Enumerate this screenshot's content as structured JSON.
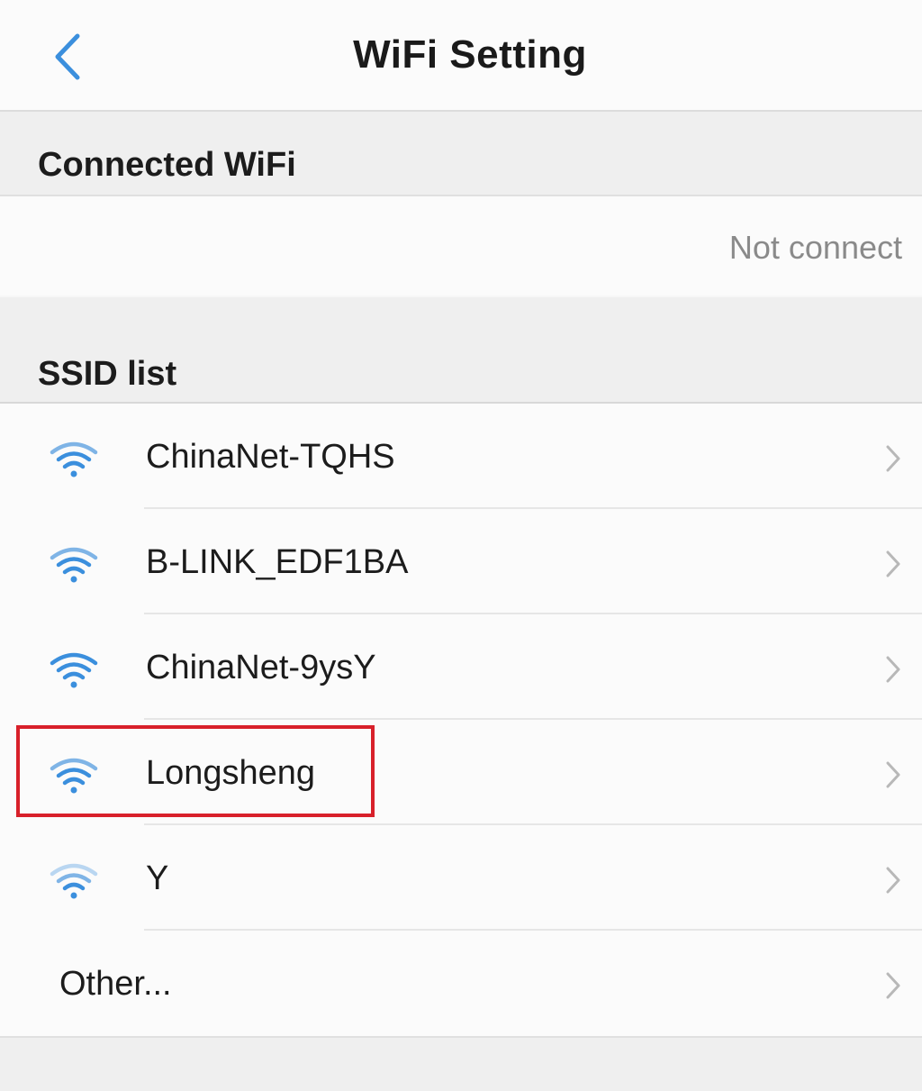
{
  "header": {
    "title": "WiFi Setting",
    "back_icon": "chevron-left-icon"
  },
  "connected_section": {
    "label": "Connected WiFi",
    "status": "Not connect"
  },
  "ssid_section": {
    "label": "SSID list",
    "items": [
      {
        "name": "ChinaNet-TQHS",
        "icon": "wifi-icon",
        "signal": 0.75
      },
      {
        "name": "B-LINK_EDF1BA",
        "icon": "wifi-icon",
        "signal": 0.75
      },
      {
        "name": "ChinaNet-9ysY",
        "icon": "wifi-icon",
        "signal": 1.0
      },
      {
        "name": "Longsheng",
        "icon": "wifi-icon",
        "signal": 0.75,
        "highlighted": true
      },
      {
        "name": "Y",
        "icon": "wifi-icon",
        "signal": 0.5
      }
    ],
    "other_label": "Other..."
  },
  "colors": {
    "accent": "#3b8fdd",
    "highlight": "#d8202a",
    "background": "#f7f7f7",
    "status_text": "#8a8a8a"
  }
}
